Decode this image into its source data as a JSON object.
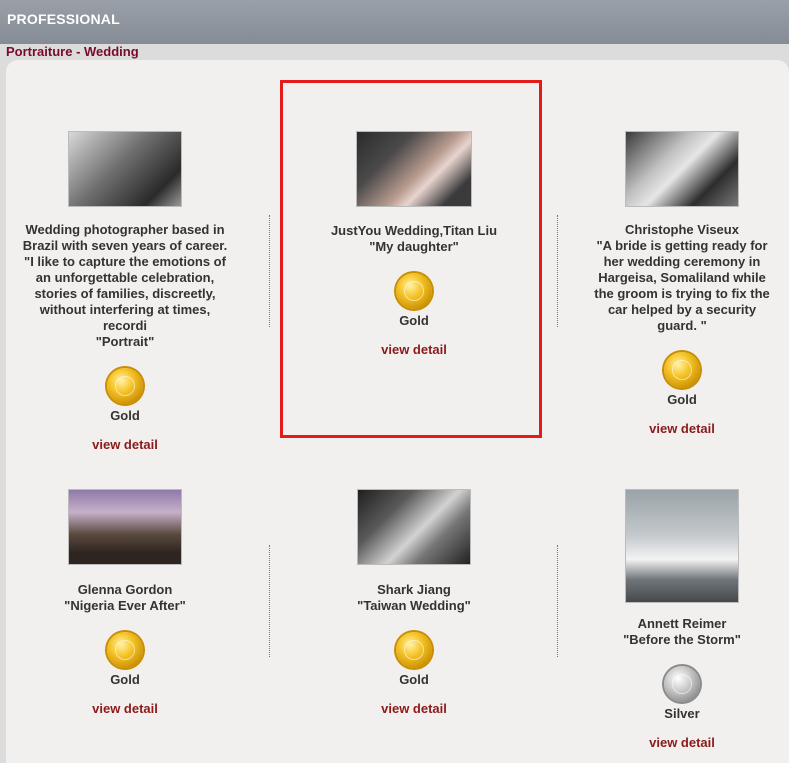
{
  "header": {
    "title": "PROFESSIONAL"
  },
  "category": "Portraiture - Wedding",
  "entries": [
    {
      "caption": "Wedding photographer based in\nBrazil with seven years of career.\n\"I like to capture the emotions of\nan unforgettable celebration,\nstories of families, discreetly,\nwithout interfering at times,\nrecordi\n\"Portrait\"",
      "award": "Gold",
      "link": "view detail"
    },
    {
      "caption": "JustYou Wedding,Titan Liu\n\"My daughter\"",
      "award": "Gold",
      "link": "view detail"
    },
    {
      "caption": "Christophe Viseux\n\"A bride is getting ready for\nher wedding ceremony in\nHargeisa, Somaliland while\nthe groom is trying to fix the\ncar helped by a security\nguard. \"",
      "award": "Gold",
      "link": "view detail"
    },
    {
      "caption": "Glenna Gordon\n\"Nigeria Ever After\"",
      "award": "Gold",
      "link": "view detail"
    },
    {
      "caption": "Shark Jiang\n\"Taiwan Wedding\"",
      "award": "Gold",
      "link": "view detail"
    },
    {
      "caption": "Annett Reimer\n\"Before the Storm\"",
      "award": "Silver",
      "link": "view detail"
    }
  ],
  "colors": {
    "highlight": "#e31b1b",
    "link": "#8b1a1a",
    "category": "#7a0a2a"
  }
}
